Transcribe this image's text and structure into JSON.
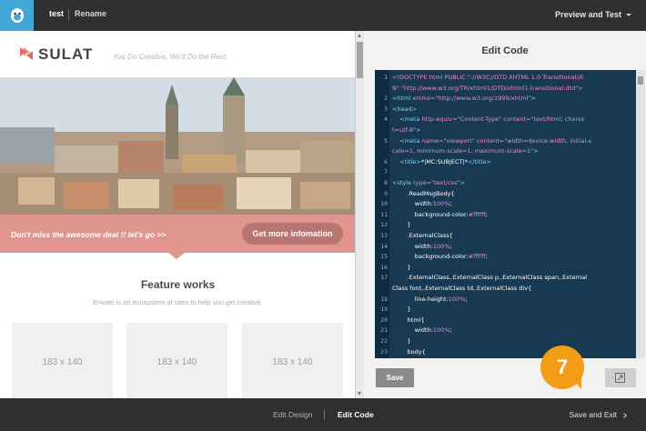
{
  "topbar": {
    "logo_icon": "chimp-logo-icon",
    "campaign_name": "test",
    "rename_label": "Rename",
    "preview_label": "Preview and Test"
  },
  "email": {
    "brand": "SULAT",
    "tagline": "You Do Creative, We'll Do the Rest.",
    "promo_text": "Don't miss the awesome deal !! let's go >>",
    "promo_button": "Get more infomation",
    "feature_title": "Feature works",
    "feature_subtitle": "Envato is an ecosystem of sites to help you get creative.",
    "placeholders": [
      "183 x 140",
      "183 x 140",
      "183 x 140"
    ]
  },
  "editor": {
    "title": "Edit Code",
    "save_label": "Save",
    "step_number": "7",
    "expand_icon": "expand-icon",
    "lines": [
      {
        "n": "1",
        "html": "<span class=\"kw\">&lt;!DOCTYPE html PUBLIC \"-//W3C//DTD XHTML 1.0 Transitional//E</span>"
      },
      {
        "n": "",
        "html": "<span class=\"kw\">N\" \"http://www.w3.org/TR/xhtml1/DTD/xhtml1-transitional.dtd\"&gt;</span>"
      },
      {
        "n": "2",
        "html": "<span class=\"tg\">&lt;html</span> <span class=\"kw\">xmlns=\"http://www.w3.org/1999/xhtml\"</span><span class=\"tg\">&gt;</span>"
      },
      {
        "n": "3",
        "html": "<span class=\"tg\">&lt;head&gt;</span>"
      },
      {
        "n": "4",
        "html": "    <span class=\"tg\">&lt;meta</span> <span class=\"kw\">http-equiv=\"Content-Type\" content=\"text/html; charse</span>"
      },
      {
        "n": "",
        "html": "<span class=\"kw\">t=utf-8\"</span><span class=\"tg\">&gt;</span>"
      },
      {
        "n": "5",
        "html": "    <span class=\"tg\">&lt;meta</span> <span class=\"kw\">name=\"viewport\" content=\"width=device-width, initial-s</span>"
      },
      {
        "n": "",
        "html": "<span class=\"kw\">cale=1, minimum-scale=1, maximum-scale=1\"</span><span class=\"tg\">&gt;</span>"
      },
      {
        "n": "6",
        "html": "    <span class=\"tg\">&lt;title&gt;</span>*|MC:SUBJECT|*<span class=\"tg\">&lt;/title&gt;</span>"
      },
      {
        "n": "7",
        "html": ""
      },
      {
        "n": "8",
        "html": "<span class=\"tg\">&lt;style</span> <span class=\"kw\">type=\"text/css\"</span><span class=\"tg\">&gt;</span>"
      },
      {
        "n": "9",
        "html": "        .ReadMsgBody{"
      },
      {
        "n": "10",
        "html": "            width:<span class=\"kw\">100%</span>;"
      },
      {
        "n": "11",
        "html": "            background-color:<span class=\"kw\">#ffffff</span>;"
      },
      {
        "n": "12",
        "html": "        }"
      },
      {
        "n": "13",
        "html": "        .ExternalClass{"
      },
      {
        "n": "14",
        "html": "            width:<span class=\"kw\">100%</span>;"
      },
      {
        "n": "15",
        "html": "            background-color:<span class=\"kw\">#ffffff</span>;"
      },
      {
        "n": "16",
        "html": "        }"
      },
      {
        "n": "17",
        "html": "        .ExternalClass,.ExternalClass p,.ExternalClass span,.External"
      },
      {
        "n": "",
        "html": "Class font,.ExternalClass td,.ExternalClass div{"
      },
      {
        "n": "18",
        "html": "            line-height:<span class=\"kw\">100%</span>;"
      },
      {
        "n": "19",
        "html": "        }"
      },
      {
        "n": "20",
        "html": "        html{"
      },
      {
        "n": "21",
        "html": "            width:<span class=\"kw\">100%</span>;"
      },
      {
        "n": "22",
        "html": "        }"
      },
      {
        "n": "23",
        "html": "        body{"
      }
    ]
  },
  "bottombar": {
    "edit_design": "Edit Design",
    "edit_code": "Edit Code",
    "save_exit": "Save and Exit"
  },
  "colors": {
    "topbar": "#2f2f2f",
    "logo_bg": "#43a7d6",
    "code_bg": "#173a52",
    "promo": "#e0968e",
    "badge": "#f39c17"
  }
}
